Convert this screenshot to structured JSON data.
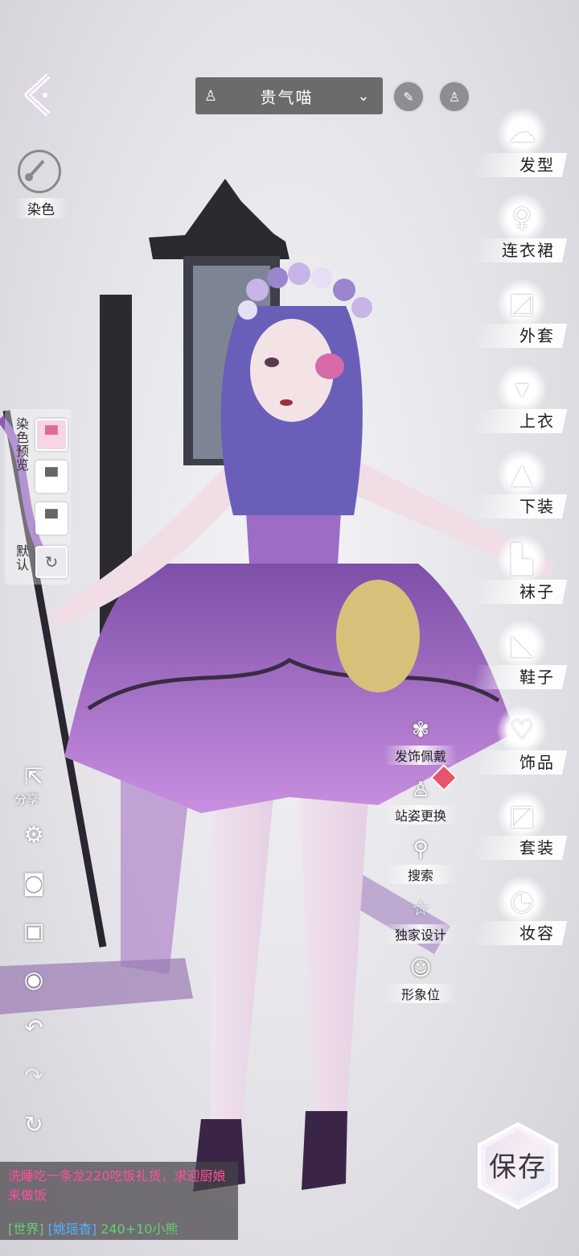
{
  "outfit": {
    "name": "贵气喵"
  },
  "left_panel": {
    "dye_label": "染色",
    "dye_preview_label": "染色预览",
    "default_label": "默认",
    "share_label": "分享"
  },
  "categories": [
    {
      "label": "发型",
      "icon": "hairstyle-icon"
    },
    {
      "label": "连衣裙",
      "icon": "dress-icon"
    },
    {
      "label": "外套",
      "icon": "coat-icon"
    },
    {
      "label": "上衣",
      "icon": "top-icon"
    },
    {
      "label": "下装",
      "icon": "skirt-icon"
    },
    {
      "label": "袜子",
      "icon": "socks-icon"
    },
    {
      "label": "鞋子",
      "icon": "shoes-icon"
    },
    {
      "label": "饰品",
      "icon": "accessory-icon"
    },
    {
      "label": "套装",
      "icon": "suit-icon"
    },
    {
      "label": "妆容",
      "icon": "makeup-icon"
    }
  ],
  "actions": [
    {
      "label": "发饰佩戴",
      "icon": "hair-ornament-icon"
    },
    {
      "label": "站姿更换",
      "icon": "pose-icon"
    },
    {
      "label": "搜索",
      "icon": "search-icon"
    },
    {
      "label": "独家设计",
      "icon": "star-icon"
    },
    {
      "label": "形象位",
      "icon": "portrait-icon"
    }
  ],
  "save": {
    "label": "保存"
  },
  "chat": {
    "message": "洗睡吃一条龙220吃饭礼货，求迎厨娘来做饭",
    "channel": "[世界]",
    "sender": "[姚瑶杳]",
    "text": "240+10小熊"
  },
  "colors": {
    "accent": "#ff4fa1",
    "channel": "#62d36b",
    "sender": "#4fb4ff"
  }
}
